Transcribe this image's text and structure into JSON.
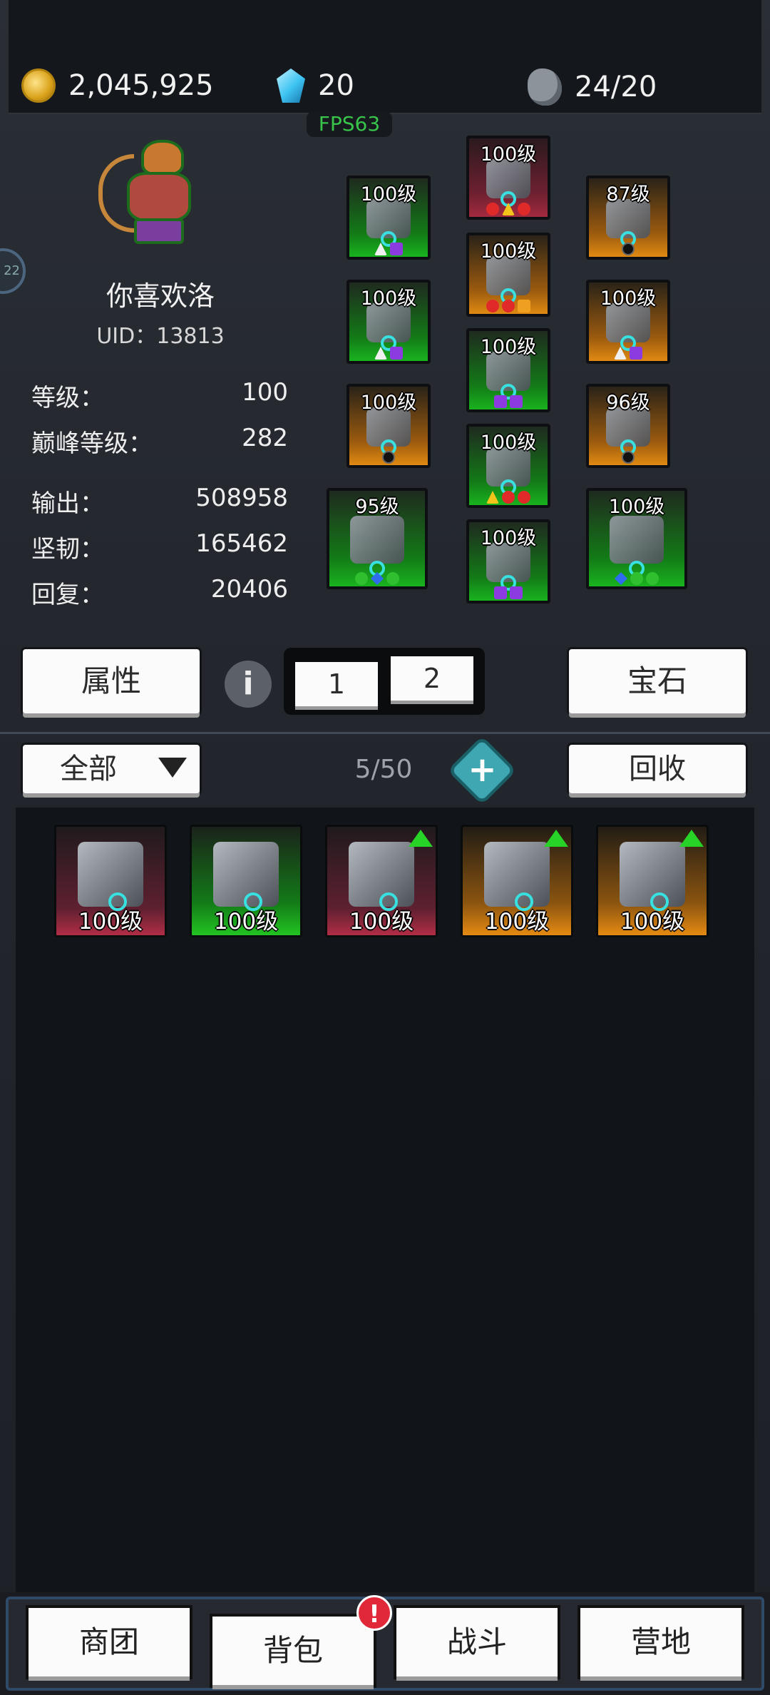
{
  "header": {
    "gold": "2,045,925",
    "gems": "20",
    "stamina": "24/20",
    "fps": "FPS63",
    "side_badge": "22"
  },
  "player": {
    "name": "你喜欢洛",
    "uid": "UID：13813"
  },
  "stats": [
    {
      "label": "等级：",
      "value": "100"
    },
    {
      "label": "巅峰等级：",
      "value": "282"
    },
    {
      "label": "输出：",
      "value": "508958"
    },
    {
      "label": "坚韧：",
      "value": "165462"
    },
    {
      "label": "回复：",
      "value": "20406"
    }
  ],
  "equipment": [
    {
      "level": "100级",
      "rarity": "green",
      "gems": [
        "white",
        "purple"
      ]
    },
    {
      "level": "100级",
      "rarity": "red",
      "gems": [
        "red",
        "yellow",
        "red"
      ]
    },
    {
      "level": "87级",
      "rarity": "orange",
      "gems": [
        "black"
      ]
    },
    {
      "level": "100级",
      "rarity": "green",
      "gems": [
        "white",
        "purple"
      ]
    },
    {
      "level": "100级",
      "rarity": "orange",
      "gems": [
        "red",
        "red",
        "orange"
      ]
    },
    {
      "level": "100级",
      "rarity": "orange",
      "gems": [
        "white",
        "purple"
      ]
    },
    {
      "level": "100级",
      "rarity": "orange",
      "gems": [
        "black"
      ]
    },
    {
      "level": "100级",
      "rarity": "green",
      "gems": [
        "purple",
        "purple"
      ]
    },
    {
      "level": "96级",
      "rarity": "orange",
      "gems": [
        "black"
      ]
    },
    {
      "level": "100级",
      "rarity": "green",
      "gems": [
        "yellow",
        "red",
        "red"
      ]
    },
    {
      "level": "95级",
      "rarity": "green",
      "gems": [
        "green",
        "blue",
        "green"
      ]
    },
    {
      "level": "100级",
      "rarity": "green",
      "gems": [
        "purple",
        "purple"
      ]
    },
    {
      "level": "100级",
      "rarity": "green",
      "gems": [
        "blue",
        "green",
        "green"
      ]
    }
  ],
  "buttons": {
    "attributes": "属性",
    "info": "i",
    "loadout_1": "1",
    "loadout_2": "2",
    "gemstone": "宝石",
    "filter": "全部",
    "recycle": "回收"
  },
  "inventory": {
    "count": "5/50",
    "items": [
      {
        "level": "100级",
        "rarity": "red",
        "upgrade": false
      },
      {
        "level": "100级",
        "rarity": "green",
        "upgrade": false
      },
      {
        "level": "100级",
        "rarity": "red",
        "upgrade": true
      },
      {
        "level": "100级",
        "rarity": "orange",
        "upgrade": true
      },
      {
        "level": "100级",
        "rarity": "orange",
        "upgrade": true
      }
    ]
  },
  "nav": {
    "guild": "商团",
    "bag": "背包",
    "battle": "战斗",
    "camp": "营地",
    "badge": "!"
  }
}
